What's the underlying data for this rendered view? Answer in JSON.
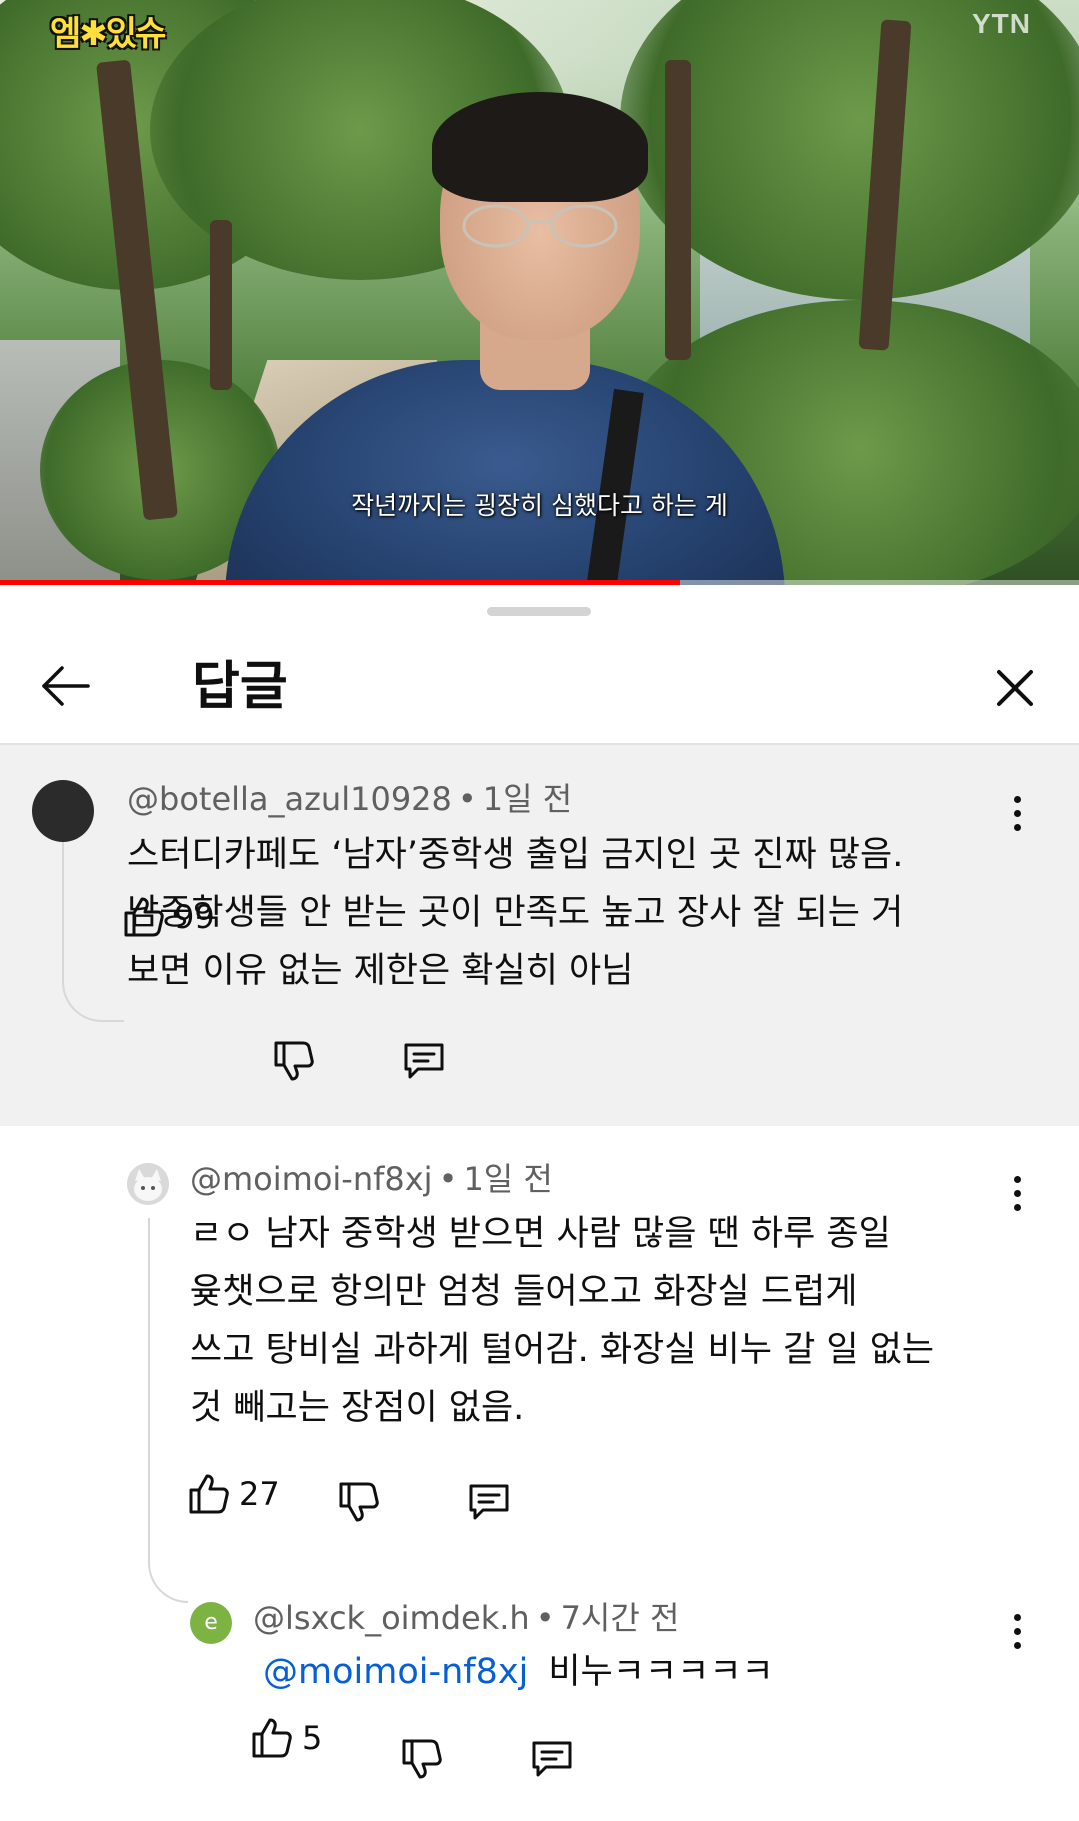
{
  "video": {
    "channel_logo": "엠✱있슈",
    "broadcaster": "YTN",
    "subtitle": "작년까지는 굉장히 심했다고 하는 게",
    "progress": 0.63,
    "progress_color": "#ff0000"
  },
  "sheet": {
    "title": "답글",
    "back_icon": "arrow-left-icon",
    "close_icon": "close-icon"
  },
  "comments": [
    {
      "author": "@botella_azul10928",
      "time": "1일 전",
      "lines": [
        "스터디카페도 ‘남자’중학생 출입 금지인 곳 진짜 많음.",
        "남중학생들 안 받는 곳이 만족도 높고 장사 잘 되는 거",
        "보면 이유 없는 제한은 확실히 아님"
      ],
      "likes": "99",
      "avatar_color": "#2b2b2b",
      "highlighted": true
    },
    {
      "author": "@moimoi-nf8xj",
      "time": "1일 전",
      "lines": [
        "ㄹㅇ 남자 중학생 받으면 사람 많을 땐 하루 종일",
        "윶챗으로 항의만 엄청 들어오고 화장실 드럽게",
        "쓰고 탕비실 과하게 털어감. 화장실 비누 갈 일 없는",
        "것 빼고는 장점이 없음."
      ],
      "likes": "27",
      "avatar_color": "#e6e6e6"
    },
    {
      "author": "@lsxck_oimdek.h",
      "time": "7시간 전",
      "mention": "@moimoi-nf8xj",
      "text": "비누ㅋㅋㅋㅋㅋ",
      "likes": "5",
      "avatar_letter": "e",
      "avatar_color": "#7cb342"
    }
  ],
  "colors": {
    "mention": "#065fd4",
    "highlight_bg": "#f1f1f1",
    "meta_text": "#606060"
  }
}
